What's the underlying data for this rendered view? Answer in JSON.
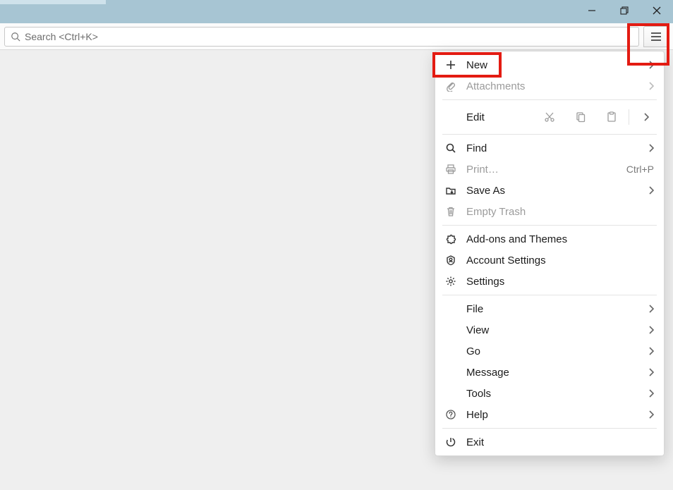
{
  "search": {
    "placeholder": "Search <Ctrl+K>"
  },
  "menu": {
    "new": "New",
    "attachments": "Attachments",
    "edit": "Edit",
    "find": "Find",
    "print": "Print…",
    "print_accel": "Ctrl+P",
    "save_as": "Save As",
    "empty_trash": "Empty Trash",
    "addons": "Add-ons and Themes",
    "account_settings": "Account Settings",
    "settings": "Settings",
    "file": "File",
    "view": "View",
    "go": "Go",
    "message": "Message",
    "tools": "Tools",
    "help": "Help",
    "exit": "Exit"
  }
}
